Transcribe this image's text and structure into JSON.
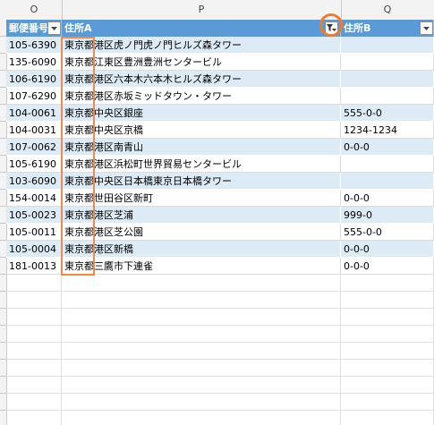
{
  "columns": {
    "letters": [
      "O",
      "P",
      "Q"
    ],
    "headers": [
      "郵便番号",
      "住所A",
      "住所B"
    ]
  },
  "rows": [
    {
      "zip": "105-6390",
      "addr_a": "東京都港区虎ノ門虎ノ門ヒルズ森タワー",
      "addr_b": ""
    },
    {
      "zip": "135-6090",
      "addr_a": "東京都江東区豊洲豊洲センタービル",
      "addr_b": ""
    },
    {
      "zip": "106-6190",
      "addr_a": "東京都港区六本木六本木ヒルズ森タワー",
      "addr_b": ""
    },
    {
      "zip": "107-6290",
      "addr_a": "東京都港区赤坂ミッドタウン・タワー",
      "addr_b": ""
    },
    {
      "zip": "104-0061",
      "addr_a": "東京都中央区銀座",
      "addr_b": "555-0-0"
    },
    {
      "zip": "104-0031",
      "addr_a": "東京都中央区京橋",
      "addr_b": "1234-1234"
    },
    {
      "zip": "107-0062",
      "addr_a": "東京都港区南青山",
      "addr_b": "0-0-0"
    },
    {
      "zip": "105-6190",
      "addr_a": "東京都港区浜松町世界貿易センタービル",
      "addr_b": ""
    },
    {
      "zip": "103-6090",
      "addr_a": "東京都中央区日本橋東京日本橋タワー",
      "addr_b": ""
    },
    {
      "zip": "154-0014",
      "addr_a": "東京都世田谷区新町",
      "addr_b": "0-0-0"
    },
    {
      "zip": "105-0023",
      "addr_a": "東京都港区芝浦",
      "addr_b": "999-0"
    },
    {
      "zip": "105-0011",
      "addr_a": "東京都港区芝公園",
      "addr_b": "555-0-0"
    },
    {
      "zip": "105-0004",
      "addr_a": "東京都港区新橋",
      "addr_b": "0-0-0"
    },
    {
      "zip": "181-0013",
      "addr_a": "東京都三鷹市下連雀",
      "addr_b": "0-0-0"
    }
  ],
  "colors": {
    "header_bg": "#5b9bd5",
    "band_bg": "#ddebf7",
    "annotation": "#ef7b2f"
  },
  "icons": {
    "filter_active": "filter-active-icon",
    "dropdown": "dropdown-arrow-icon"
  }
}
